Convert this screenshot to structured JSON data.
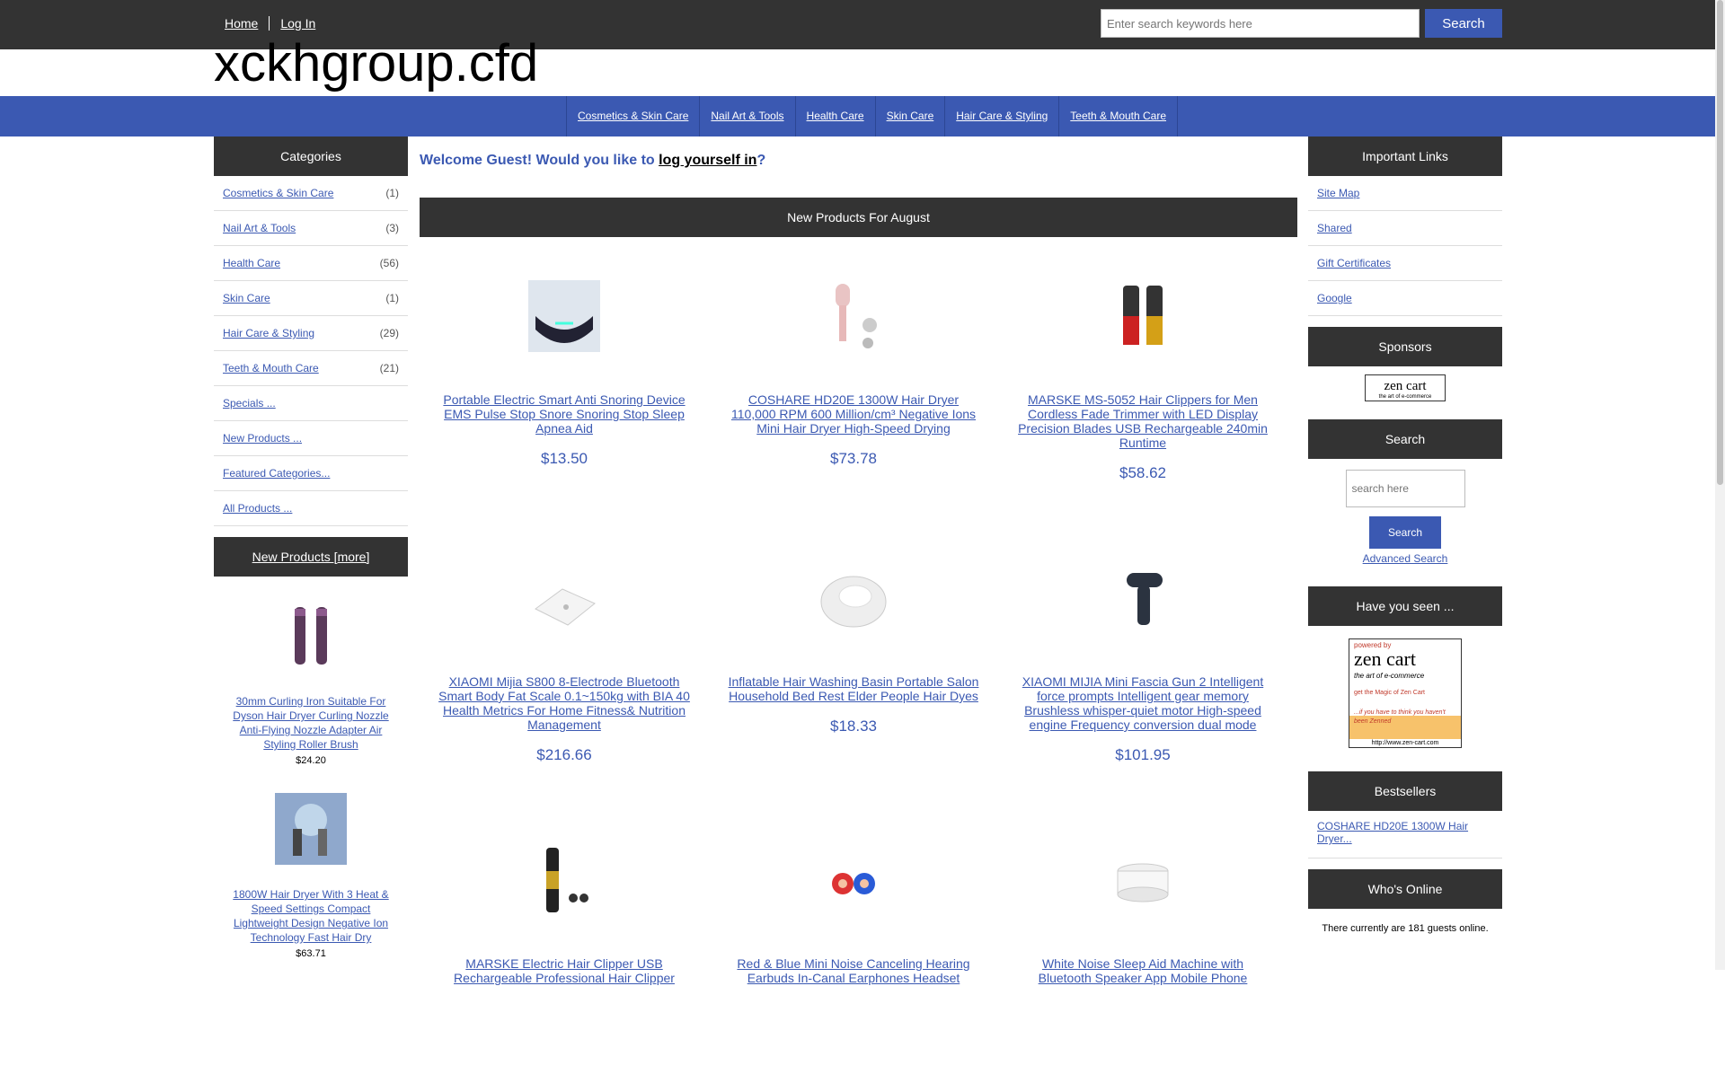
{
  "topnav": {
    "home": "Home",
    "login": "Log In"
  },
  "topsearch": {
    "placeholder": "Enter search keywords here",
    "button": "Search"
  },
  "site": {
    "logo": "xckhgroup.cfd"
  },
  "categories_tabs": [
    "Cosmetics & Skin Care",
    "Nail Art & Tools",
    "Health Care",
    "Skin Care",
    "Hair Care & Styling",
    "Teeth & Mouth Care"
  ],
  "left": {
    "categories_title": "Categories",
    "categories": [
      {
        "label": "Cosmetics & Skin Care",
        "count": "(1)"
      },
      {
        "label": "Nail Art & Tools",
        "count": "(3)"
      },
      {
        "label": "Health Care",
        "count": "(56)"
      },
      {
        "label": "Skin Care",
        "count": "(1)"
      },
      {
        "label": "Hair Care & Styling",
        "count": "(29)"
      },
      {
        "label": "Teeth & Mouth Care",
        "count": "(21)"
      }
    ],
    "extra_links": [
      "Specials ...",
      "New Products ...",
      "Featured Categories...",
      "All Products ..."
    ],
    "new_products_title": "New Products  [more]",
    "new_products": [
      {
        "title": "30mm Curling Iron Suitable For Dyson Hair Dryer Curling Nozzle Anti-Flying Nozzle Adapter Air Styling Roller Brush",
        "price": "$24.20"
      },
      {
        "title": "1800W Hair Dryer With 3 Heat & Speed Settings Compact Lightweight Design Negative Ion Technology Fast Hair Dry",
        "price": "$63.71"
      }
    ]
  },
  "main": {
    "welcome_prefix": "Welcome Guest! Would you like to ",
    "welcome_link": "log yourself in",
    "welcome_suffix": "?",
    "section_title": "New Products For August",
    "products": [
      {
        "title": "Portable Electric Smart Anti Snoring Device EMS Pulse Stop Snore Snoring Stop Sleep Apnea Aid",
        "price": "$13.50"
      },
      {
        "title": "COSHARE HD20E 1300W Hair Dryer 110,000 RPM 600 Million/cm³ Negative Ions Mini Hair Dryer High-Speed Drying",
        "price": "$73.78"
      },
      {
        "title": "MARSKE MS-5052 Hair Clippers for Men Cordless Fade Trimmer with LED Display Precision Blades USB Rechargeable 240min Runtime",
        "price": "$58.62"
      },
      {
        "title": "XIAOMI Mijia S800 8-Electrode Bluetooth Smart Body Fat Scale 0.1~150kg with BIA 40 Health Metrics For Home Fitness& Nutrition Management",
        "price": "$216.66"
      },
      {
        "title": "Inflatable Hair Washing Basin Portable Salon Household Bed Rest Elder People Hair Dyes",
        "price": "$18.33"
      },
      {
        "title": "XIAOMI MIJIA Mini Fascia Gun 2 Intelligent force prompts Intelligent gear memory Brushless whisper-quiet motor High-speed engine Frequency conversion dual mode",
        "price": "$101.95"
      },
      {
        "title": "MARSKE Electric Hair Clipper USB Rechargeable Professional Hair Clipper",
        "price": ""
      },
      {
        "title": "Red & Blue Mini Noise Canceling Hearing Earbuds In-Canal Earphones Headset",
        "price": ""
      },
      {
        "title": "White Noise Sleep Aid Machine with Bluetooth Speaker App Mobile Phone",
        "price": ""
      }
    ]
  },
  "right": {
    "links_title": "Important Links",
    "links": [
      "Site Map",
      "Shared",
      "Gift Certificates",
      "Google"
    ],
    "sponsors_title": "Sponsors",
    "sponsor_logo": "zen cart",
    "sponsor_tagline": "the art of e-commerce",
    "search_title": "Search",
    "search_placeholder": "search here",
    "search_button": "Search",
    "advanced_search": "Advanced Search",
    "have_seen_title": "Have you seen ...",
    "have_seen_banner": {
      "powered": "powered by",
      "brand": "zen cart",
      "tag": "the art of e-commerce",
      "magic": "get the Magic of Zen Cart",
      "think": "...if you have to think you haven't been Zenned",
      "url": "http://www.zen-cart.com"
    },
    "bestsellers_title": "Bestsellers",
    "bestseller": "COSHARE HD20E 1300W Hair Dryer...",
    "whos_online_title": "Who's Online",
    "whos_online_text": "There currently are 181 guests online."
  },
  "colors": {
    "accent": "#3b59b2",
    "header": "#333333"
  }
}
